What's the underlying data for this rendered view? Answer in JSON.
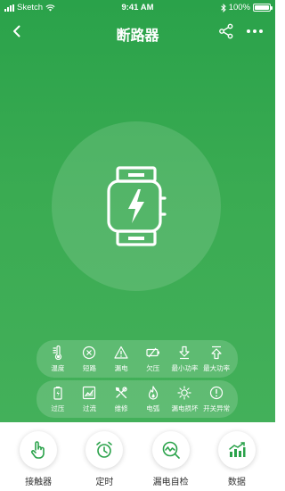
{
  "status": {
    "carrier": "Sketch",
    "time": "9:41 AM",
    "battery": "100%"
  },
  "nav": {
    "title": "断路器"
  },
  "indicators_top": [
    {
      "label": "温度",
      "icon": "thermometer-icon"
    },
    {
      "label": "短路",
      "icon": "x-circle-icon"
    },
    {
      "label": "漏电",
      "icon": "warning-triangle-icon"
    },
    {
      "label": "欠压",
      "icon": "low-battery-icon"
    },
    {
      "label": "最小功率",
      "icon": "arrow-down-icon"
    },
    {
      "label": "最大功率",
      "icon": "arrow-up-icon"
    }
  ],
  "indicators_bottom": [
    {
      "label": "过压",
      "icon": "battery-bolt-icon"
    },
    {
      "label": "过流",
      "icon": "chart-box-icon"
    },
    {
      "label": "维修",
      "icon": "tools-icon"
    },
    {
      "label": "电弧",
      "icon": "flame-icon"
    },
    {
      "label": "漏电损坏",
      "icon": "burst-icon"
    },
    {
      "label": "开关异常",
      "icon": "alert-circle-icon"
    }
  ],
  "tabs": [
    {
      "label": "接触器",
      "icon": "hand-touch-icon"
    },
    {
      "label": "定时",
      "icon": "alarm-clock-icon"
    },
    {
      "label": "漏电自检",
      "icon": "search-wave-icon"
    },
    {
      "label": "数据",
      "icon": "bar-chart-icon"
    }
  ],
  "colors": {
    "primary": "#2aa24a",
    "icon_green": "#2aa24a",
    "text_dark": "#333333"
  }
}
